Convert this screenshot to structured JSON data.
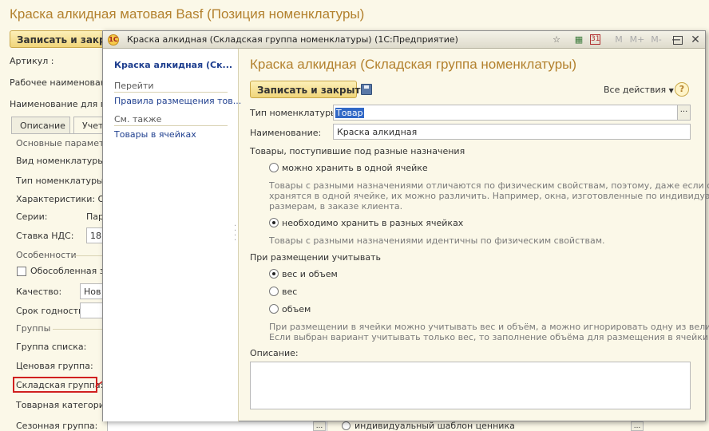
{
  "background_form": {
    "title": "Краска алкидная матовая Basf (Позиция номенклатуры)",
    "save_close_button": "Записать и закры",
    "labels": {
      "article": "Артикул :",
      "working_name": "Рабочее наименовани",
      "print_name": "Наименование для пе"
    },
    "tabs": [
      "Описание",
      "Учет"
    ],
    "sections": {
      "basic_params": "Основные параметр",
      "features": "Особенности",
      "groups": "Группы"
    },
    "fields": {
      "item_kind": "Вид номенклатуры:",
      "item_type": "Тип номенклатуры:",
      "characteristics": "Характеристики: Об",
      "series": "Серии:",
      "series_value": "Пар",
      "vat_rate": "Ставка НДС:",
      "vat_value": "18",
      "separate": "Обособленная за",
      "quality": "Качество:",
      "quality_value": "Нов",
      "expiry": "Срок годности:",
      "list_group": "Группа списка:",
      "price_group": "Ценовая группа:",
      "warehouse_group": "Складская группа:",
      "goods_category": "Товарная категория",
      "season_group": "Сезонная группа:",
      "price_tag": "индивидуальный шаблон ценника"
    }
  },
  "dialog": {
    "window_title": "Краска алкидная (Складская группа номенклатуры)  (1С:Предприятие)",
    "logo": "1С",
    "toolbar_icons": [
      "star-icon",
      "calculator-icon",
      "calendar-icon",
      "memory-icons",
      "minimize-icon",
      "maximize-icon",
      "close-icon"
    ],
    "memory_labels": [
      "M",
      "M+",
      "M-"
    ],
    "nav": {
      "current": "Краска алкидная (Ск...",
      "goto_header": "Перейти",
      "goto_items": [
        "Правила размещения тов..."
      ],
      "see_also_header": "См. также",
      "see_also_items": [
        "Товары в ячейках"
      ]
    },
    "title": "Краска алкидная (Складская группа номенклатуры)",
    "save_close_button": "Записать и закрыть",
    "all_actions": "Все действия",
    "help": "?",
    "item_type_label": "Тип номенклатуры:",
    "item_type_value": "Товар",
    "name_label": "Наименование:",
    "name_value": "Краска алкидная",
    "purpose_header": "Товары, поступившие под разные назначения",
    "radio_one_cell": "можно хранить в одной ячейке",
    "hint_one_cell_1": "Товары с разными назначениями отличаются по физическим свойствам, поэтому, даже если они",
    "hint_one_cell_2": "хранятся в одной ячейке, их можно различить. Например, окна, изготовленные по индивидуальным",
    "hint_one_cell_3": "размерам, в заказе клиента.",
    "radio_diff_cells": "необходимо хранить в разных ячейках",
    "hint_diff_cells": "Товары с разными назначениями идентичны по физическим свойствам.",
    "placement_header": "При размещении учитывать",
    "radio_weight_volume": "вес и объем",
    "radio_weight": "вес",
    "radio_volume": "объем",
    "hint_placement_1": "При размещении в ячейки можно учитывать вес и объём, а можно игнорировать одну из величин.",
    "hint_placement_2": "Если выбран вариант учитывать только вес, то заполнение объёма для размещения в ячейки не",
    "description_label": "Описание:",
    "description_value": ""
  },
  "colors": {
    "title": "#b3812e",
    "link": "#1f3f8f",
    "highlight": "#d02020",
    "background": "#fbf8e8"
  }
}
